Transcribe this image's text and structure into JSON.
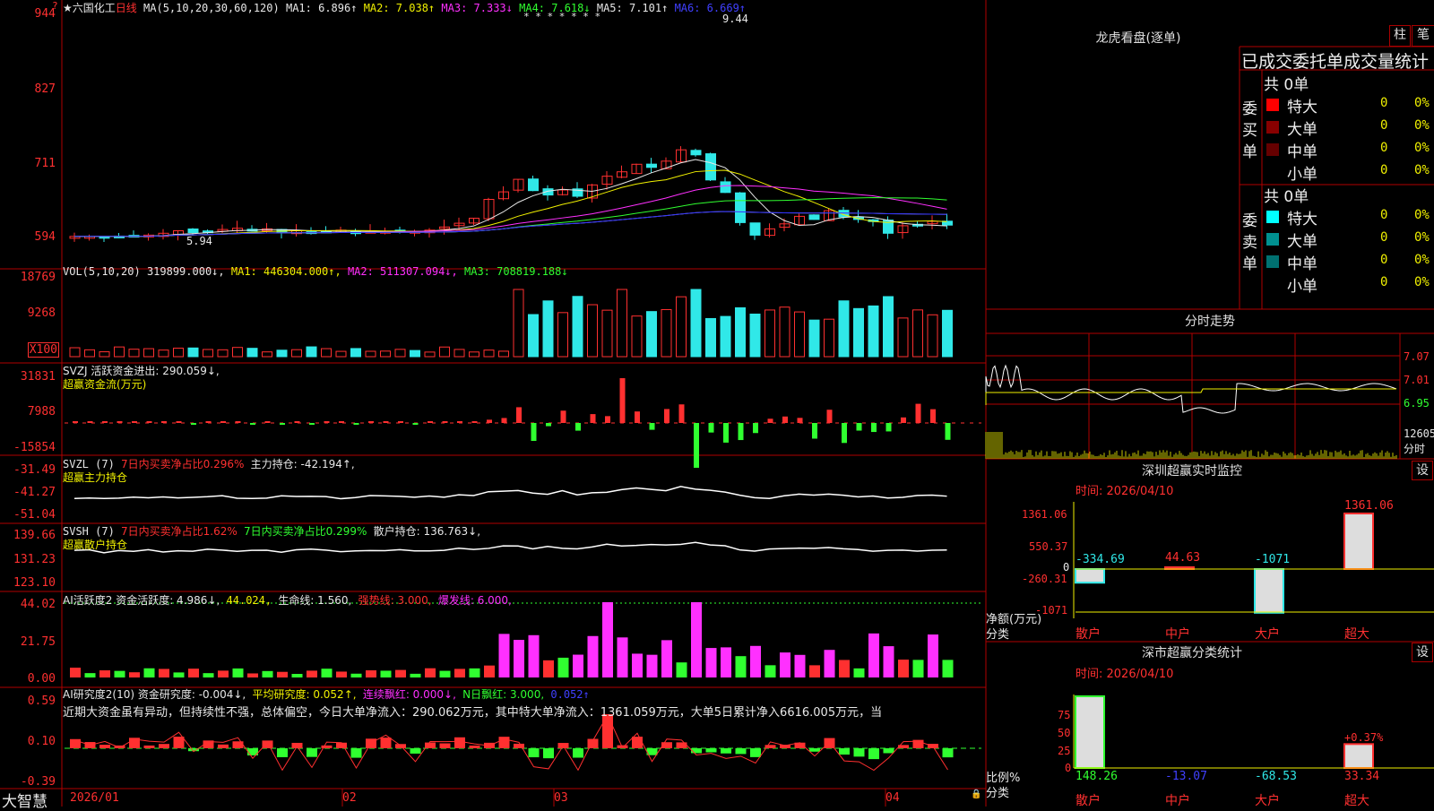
{
  "header": {
    "stock_name": "★六国化工",
    "period": "日线",
    "ma_main": "MA(5,10,20,30,60,120)",
    "ma1": "MA1: 6.896↑",
    "ma2": "MA2: 7.038↑",
    "ma3": "MA3: 7.333↓",
    "ma4": "MA4: 7.618↓",
    "ma5": "MA5: 7.101↑",
    "ma6": "MA6: 6.669↑",
    "high_mark": "9.44",
    "low_mark": "5.94",
    "stars": "* * *   *    * * *"
  },
  "price_axis": [
    "944",
    "827",
    "711",
    "594"
  ],
  "vol": {
    "axis": [
      "18769",
      "9268",
      "X100"
    ],
    "title": "VOL(5,10,20)",
    "val": "319899.000↓,",
    "ma1": "MA1: 446304.000↑,",
    "ma2": "MA2: 511307.094↓,",
    "ma3": "MA3: 708819.188↓"
  },
  "svzj": {
    "axis": [
      "31831",
      "7988",
      "-15854"
    ],
    "line1": "SVZJ  活跃资金进出: 290.059↓,",
    "line2": "超赢资金流(万元)"
  },
  "svzl": {
    "axis": [
      "-31.49",
      "-41.27",
      "-51.04"
    ],
    "t1": "SVZL (7)",
    "t2": "7日内买卖净占比0.296%",
    "t3": "主力持仓: -42.194↑,",
    "line2": "超赢主力持仓"
  },
  "svsh": {
    "axis": [
      "139.66",
      "131.23",
      "123.10"
    ],
    "t1": "SVSH (7)",
    "t2": "7日内买卖净占比1.62%",
    "t3": "7日内买卖净占比0.299%",
    "t4": "散户持仓: 136.763↓,",
    "line2": "超赢散户持仓"
  },
  "ai1": {
    "axis": [
      "44.02",
      "21.75",
      "0.00"
    ],
    "t1": "AI活跃度2 资金活跃度: 4.986↓,",
    "t2": "44.024,",
    "t3": "生命线: 1.560,",
    "t4": "强势线: 3.000,",
    "t5": "爆发线: 6.000,"
  },
  "ai2": {
    "axis": [
      "0.59",
      "0.10",
      "-0.39"
    ],
    "t1": "AI研究度2(10) 资金研究度: -0.004↓,",
    "t2": "平均研究度: 0.052↑,",
    "t3": "连续飘红: 0.000↓,",
    "t4": "N日飘红: 3.000,",
    "t5": "0.052↑",
    "comment": "近期大资金虽有异动，但持续性不强，总体偏空，今日大单净流入：290.062万元，其中特大单净流入：1361.059万元，大单5日累计净入6616.005万元，当"
  },
  "dates": [
    "2026/01",
    "02",
    "03",
    "04"
  ],
  "logo": "大智慧",
  "lhb": {
    "title": "龙虎看盘(逐单)",
    "btn1": "柱",
    "btn2": "笔",
    "subtitle": "已成交委托单成交量统计",
    "buy_label": "委买单",
    "sell_label": "委卖单",
    "buy_total": "共 0单",
    "sell_total": "共 0单",
    "buy_rows": [
      {
        "name": "特大",
        "v": "0",
        "p": "0%",
        "color": "#ff0000"
      },
      {
        "name": "大单",
        "v": "0",
        "p": "0%",
        "color": "#880000"
      },
      {
        "name": "中单",
        "v": "0",
        "p": "0%",
        "color": "#660000"
      },
      {
        "name": "小单",
        "v": "0",
        "p": "0%",
        "color": "#000000"
      }
    ],
    "sell_rows": [
      {
        "name": "特大",
        "v": "0",
        "p": "0%",
        "color": "#00ffff"
      },
      {
        "name": "大单",
        "v": "0",
        "p": "0%",
        "color": "#009090"
      },
      {
        "name": "中单",
        "v": "0",
        "p": "0%",
        "color": "#007070"
      },
      {
        "name": "小单",
        "v": "0",
        "p": "0%",
        "color": "#000000"
      }
    ]
  },
  "intraday": {
    "title": "分时走势",
    "axis": [
      "7.07",
      "7.01",
      "6.95",
      "12605",
      "分时"
    ]
  },
  "sz_monitor": {
    "title": "深圳超赢实时监控",
    "btn": "设",
    "time": "时间: 2026/04/10",
    "axis": [
      "1361.06",
      "550.37",
      "0",
      "-260.31",
      "-1071"
    ],
    "unit1": "净额(万元)",
    "unit2": "分类",
    "bars": [
      {
        "label": "散户",
        "value": "-334.69"
      },
      {
        "label": "中户",
        "value": "44.63"
      },
      {
        "label": "大户",
        "value": "-1071"
      },
      {
        "label": "超大",
        "value": "1361.06"
      }
    ]
  },
  "sz_class": {
    "title": "深市超赢分类统计",
    "btn": "设",
    "time": "时间: 2026/04/10",
    "axis": [
      "75",
      "50",
      "25",
      "0"
    ],
    "unit1": "比例%",
    "unit2": "分类",
    "bars": [
      {
        "label": "散户",
        "value": "148.26"
      },
      {
        "label": "中户",
        "value": "-13.07"
      },
      {
        "label": "大户",
        "value": "-68.53"
      },
      {
        "label": "超大",
        "value": "33.34"
      }
    ],
    "note": "+0.37%"
  }
}
